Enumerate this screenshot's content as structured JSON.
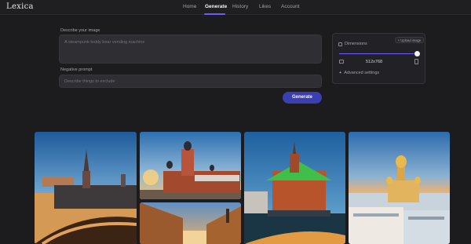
{
  "app": {
    "logo": "Lexica"
  },
  "nav": {
    "items": [
      {
        "label": "Home"
      },
      {
        "label": "Generate"
      },
      {
        "label": "History"
      },
      {
        "label": "Likes"
      },
      {
        "label": "Account"
      }
    ],
    "active": "Generate"
  },
  "form": {
    "prompt_label": "Describe your image",
    "prompt_placeholder": "A steampunk teddy bear vending machine",
    "negative_label": "Negative prompt",
    "negative_placeholder": "Describe things to exclude",
    "generate_label": "Generate"
  },
  "settings": {
    "upload_label": "+ Upload image",
    "dimensions_label": "Dimensions",
    "dimensions_checked": false,
    "dimensions_value": "512x768",
    "slider_fraction": 0.95,
    "advanced_label": "Advanced settings",
    "accent": "#6d5efc",
    "button_color": "#3b3fb0"
  },
  "gallery": {
    "items": [
      {
        "icon": "image-cathedral-spire-sunset"
      },
      {
        "icon": "image-red-church-sunrise"
      },
      {
        "icon": "image-street-buildings-dusk"
      },
      {
        "icon": "image-green-roof-cathedral"
      },
      {
        "icon": "image-golden-dome-city"
      }
    ]
  }
}
